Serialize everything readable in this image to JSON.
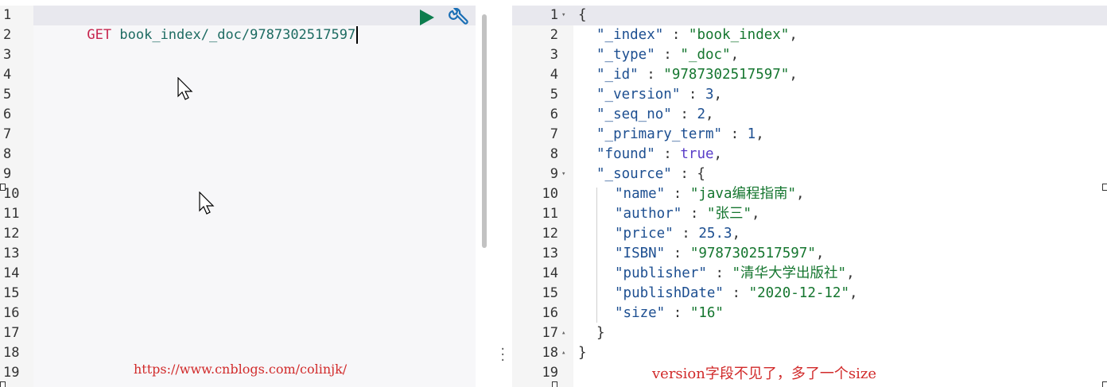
{
  "request": {
    "method": "GET",
    "path": "book_index/_doc/9787302517597",
    "line_numbers": [
      "1",
      "2",
      "3",
      "4",
      "5",
      "6",
      "7",
      "8",
      "9",
      "10",
      "11",
      "12",
      "13",
      "14",
      "15",
      "16",
      "17",
      "18",
      "19"
    ]
  },
  "actions": {
    "run_icon": "play-icon",
    "settings_icon": "wrench-icon"
  },
  "watermark": {
    "url": "https://www.cnblogs.com/colinjk/"
  },
  "response": {
    "lines": [
      {
        "n": "1",
        "fold": "▾",
        "indent": 0,
        "parts": [
          [
            "p",
            "{"
          ]
        ]
      },
      {
        "n": "2",
        "fold": "",
        "indent": 1,
        "parts": [
          [
            "k",
            "\"_index\""
          ],
          [
            "p",
            " : "
          ],
          [
            "s",
            "\"book_index\""
          ],
          [
            "p",
            ","
          ]
        ]
      },
      {
        "n": "3",
        "fold": "",
        "indent": 1,
        "parts": [
          [
            "k",
            "\"_type\""
          ],
          [
            "p",
            " : "
          ],
          [
            "s",
            "\"_doc\""
          ],
          [
            "p",
            ","
          ]
        ]
      },
      {
        "n": "4",
        "fold": "",
        "indent": 1,
        "parts": [
          [
            "k",
            "\"_id\""
          ],
          [
            "p",
            " : "
          ],
          [
            "s",
            "\"9787302517597\""
          ],
          [
            "p",
            ","
          ]
        ]
      },
      {
        "n": "5",
        "fold": "",
        "indent": 1,
        "parts": [
          [
            "k",
            "\"_version\""
          ],
          [
            "p",
            " : "
          ],
          [
            "n",
            "3"
          ],
          [
            "p",
            ","
          ]
        ]
      },
      {
        "n": "6",
        "fold": "",
        "indent": 1,
        "parts": [
          [
            "k",
            "\"_seq_no\""
          ],
          [
            "p",
            " : "
          ],
          [
            "n",
            "2"
          ],
          [
            "p",
            ","
          ]
        ]
      },
      {
        "n": "7",
        "fold": "",
        "indent": 1,
        "parts": [
          [
            "k",
            "\"_primary_term\""
          ],
          [
            "p",
            " : "
          ],
          [
            "n",
            "1"
          ],
          [
            "p",
            ","
          ]
        ]
      },
      {
        "n": "8",
        "fold": "",
        "indent": 1,
        "parts": [
          [
            "k",
            "\"found\""
          ],
          [
            "p",
            " : "
          ],
          [
            "b",
            "true"
          ],
          [
            "p",
            ","
          ]
        ]
      },
      {
        "n": "9",
        "fold": "▾",
        "indent": 1,
        "parts": [
          [
            "k",
            "\"_source\""
          ],
          [
            "p",
            " : {"
          ]
        ]
      },
      {
        "n": "10",
        "fold": "",
        "indent": 2,
        "parts": [
          [
            "k",
            "\"name\""
          ],
          [
            "p",
            " : "
          ],
          [
            "s",
            "\"java编程指南\""
          ],
          [
            "p",
            ","
          ]
        ]
      },
      {
        "n": "11",
        "fold": "",
        "indent": 2,
        "parts": [
          [
            "k",
            "\"author\""
          ],
          [
            "p",
            " : "
          ],
          [
            "s",
            "\"张三\""
          ],
          [
            "p",
            ","
          ]
        ]
      },
      {
        "n": "12",
        "fold": "",
        "indent": 2,
        "parts": [
          [
            "k",
            "\"price\""
          ],
          [
            "p",
            " : "
          ],
          [
            "n",
            "25.3"
          ],
          [
            "p",
            ","
          ]
        ]
      },
      {
        "n": "13",
        "fold": "",
        "indent": 2,
        "parts": [
          [
            "k",
            "\"ISBN\""
          ],
          [
            "p",
            " : "
          ],
          [
            "s",
            "\"9787302517597\""
          ],
          [
            "p",
            ","
          ]
        ]
      },
      {
        "n": "14",
        "fold": "",
        "indent": 2,
        "parts": [
          [
            "k",
            "\"publisher\""
          ],
          [
            "p",
            " : "
          ],
          [
            "s",
            "\"清华大学出版社\""
          ],
          [
            "p",
            ","
          ]
        ]
      },
      {
        "n": "15",
        "fold": "",
        "indent": 2,
        "parts": [
          [
            "k",
            "\"publishDate\""
          ],
          [
            "p",
            " : "
          ],
          [
            "s",
            "\"2020-12-12\""
          ],
          [
            "p",
            ","
          ]
        ]
      },
      {
        "n": "16",
        "fold": "",
        "indent": 2,
        "parts": [
          [
            "k",
            "\"size\""
          ],
          [
            "p",
            " : "
          ],
          [
            "s",
            "\"16\""
          ]
        ]
      },
      {
        "n": "17",
        "fold": "▴",
        "indent": 1,
        "parts": [
          [
            "p",
            "}"
          ]
        ]
      },
      {
        "n": "18",
        "fold": "▴",
        "indent": 0,
        "parts": [
          [
            "p",
            "}"
          ]
        ]
      },
      {
        "n": "19",
        "fold": "",
        "indent": 0,
        "parts": []
      }
    ]
  },
  "annotation": {
    "note": "version字段不见了，多了一个size"
  },
  "colors": {
    "method": "#c7254e",
    "path": "#1d6b62",
    "key": "#1d4f91",
    "string": "#15762f",
    "boolean": "#5a3ec8",
    "annotation": "#d12a2a",
    "run_button": "#0d7d4e",
    "settings_button": "#1a6fb5"
  }
}
